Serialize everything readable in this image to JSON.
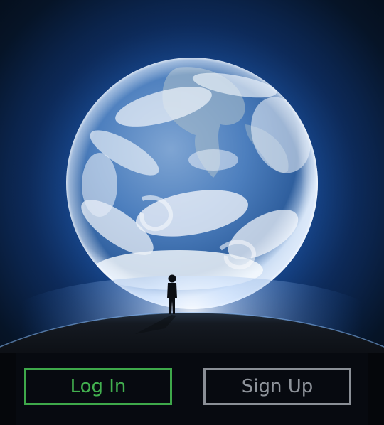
{
  "login_button": {
    "label": "Log In",
    "color": "#42b04f"
  },
  "signup_button": {
    "label": "Sign Up",
    "color": "#8e939a"
  },
  "hero": {
    "subject": "earth-with-standing-person",
    "icons": [
      "earth-globe-icon",
      "person-silhouette-icon",
      "horizon-ground-icon"
    ]
  },
  "colors": {
    "space_dark": "#03070d",
    "space_glow": "#1a4d9a",
    "earth_ocean": "#3e6fa8",
    "earth_cloud": "#eef3fa",
    "ground": "#171b22"
  }
}
